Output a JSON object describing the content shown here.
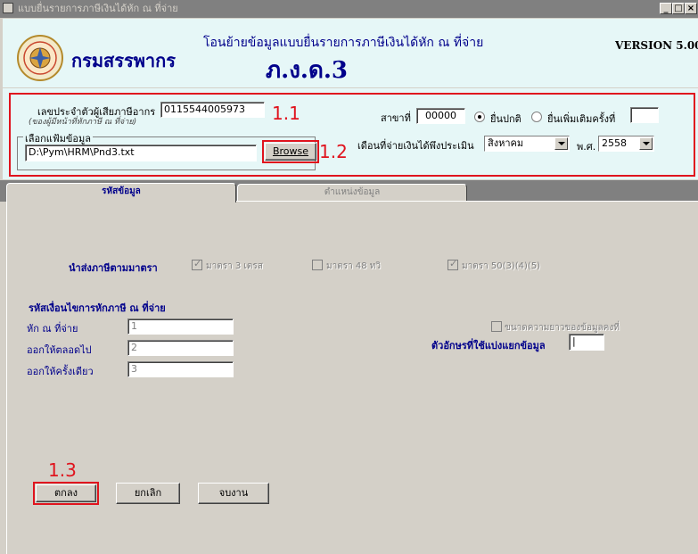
{
  "window": {
    "title": "แบบยื่นรายการภาษีเงินได้หัก ณ ที่จ่าย",
    "min_glyph": "_",
    "max_glyph": "□",
    "close_glyph": "×"
  },
  "header": {
    "department": "กรมสรรพากร",
    "subtitle": "โอนย้ายข้อมูลแบบยื่นรายการภาษีเงินได้หัก ณ ที่จ่าย",
    "form_title": "ภ.ง.ด.3",
    "version": "VERSION 5.00"
  },
  "annotations": {
    "a11": "1.1",
    "a12": "1.2",
    "a13": "1.3",
    "color": "#e0141e"
  },
  "taxpayer": {
    "tax_id_label": "เลขประจำตัวผู้เสียภาษีอากร",
    "tax_id_note": "(ของผู้มีหน้าที่หักภาษี ณ ที่จ่าย)",
    "tax_id_value": "0115544005973",
    "branch_label": "สาขาที่",
    "branch_value": "00000",
    "radio_normal": "ยื่นปกติ",
    "radio_additional": "ยื่นเพิ่มเติมครั้งที่",
    "additional_value": "",
    "month_label": "เดือนที่จ่ายเงินได้พึงประเมิน",
    "month_value": "สิงหาคม",
    "year_label": "พ.ศ.",
    "year_value": "2558"
  },
  "file_select": {
    "group_label": "เลือกแฟ้มข้อมูล",
    "path_value": "D:\\Pym\\HRM\\Pnd3.txt",
    "browse_label": "Browse"
  },
  "tabs": [
    {
      "label": "รหัสข้อมูล",
      "active": true
    },
    {
      "label": "ตำแหน่งข้อมูล",
      "active": false
    }
  ],
  "sections": {
    "section_label": "นำส่งภาษีตามมาตรา",
    "checks": [
      {
        "label": "มาตรา 3 เตรส",
        "checked": true
      },
      {
        "label": "มาตรา 48 ทวิ",
        "checked": false
      },
      {
        "label": "มาตรา 50(3)(4)(5)",
        "checked": true
      }
    ],
    "condition_title": "รหัสเงื่อนไขการหักภาษี ณ ที่จ่าย",
    "conditions": [
      {
        "label": "หัก ณ ที่จ่าย",
        "value": "1"
      },
      {
        "label": "ออกให้ตลอดไป",
        "value": "2"
      },
      {
        "label": "ออกให้ครั้งเดียว",
        "value": "3"
      }
    ],
    "fixed_length_label": "ขนาดความยาวของข้อมูลคงที่",
    "delimiter_label": "ตัวอักษรที่ใช้แบ่งแยกข้อมูล",
    "delimiter_value": "|"
  },
  "buttons": {
    "ok": "ตกลง",
    "cancel": "ยกเลิก",
    "exit": "จบงาน"
  }
}
